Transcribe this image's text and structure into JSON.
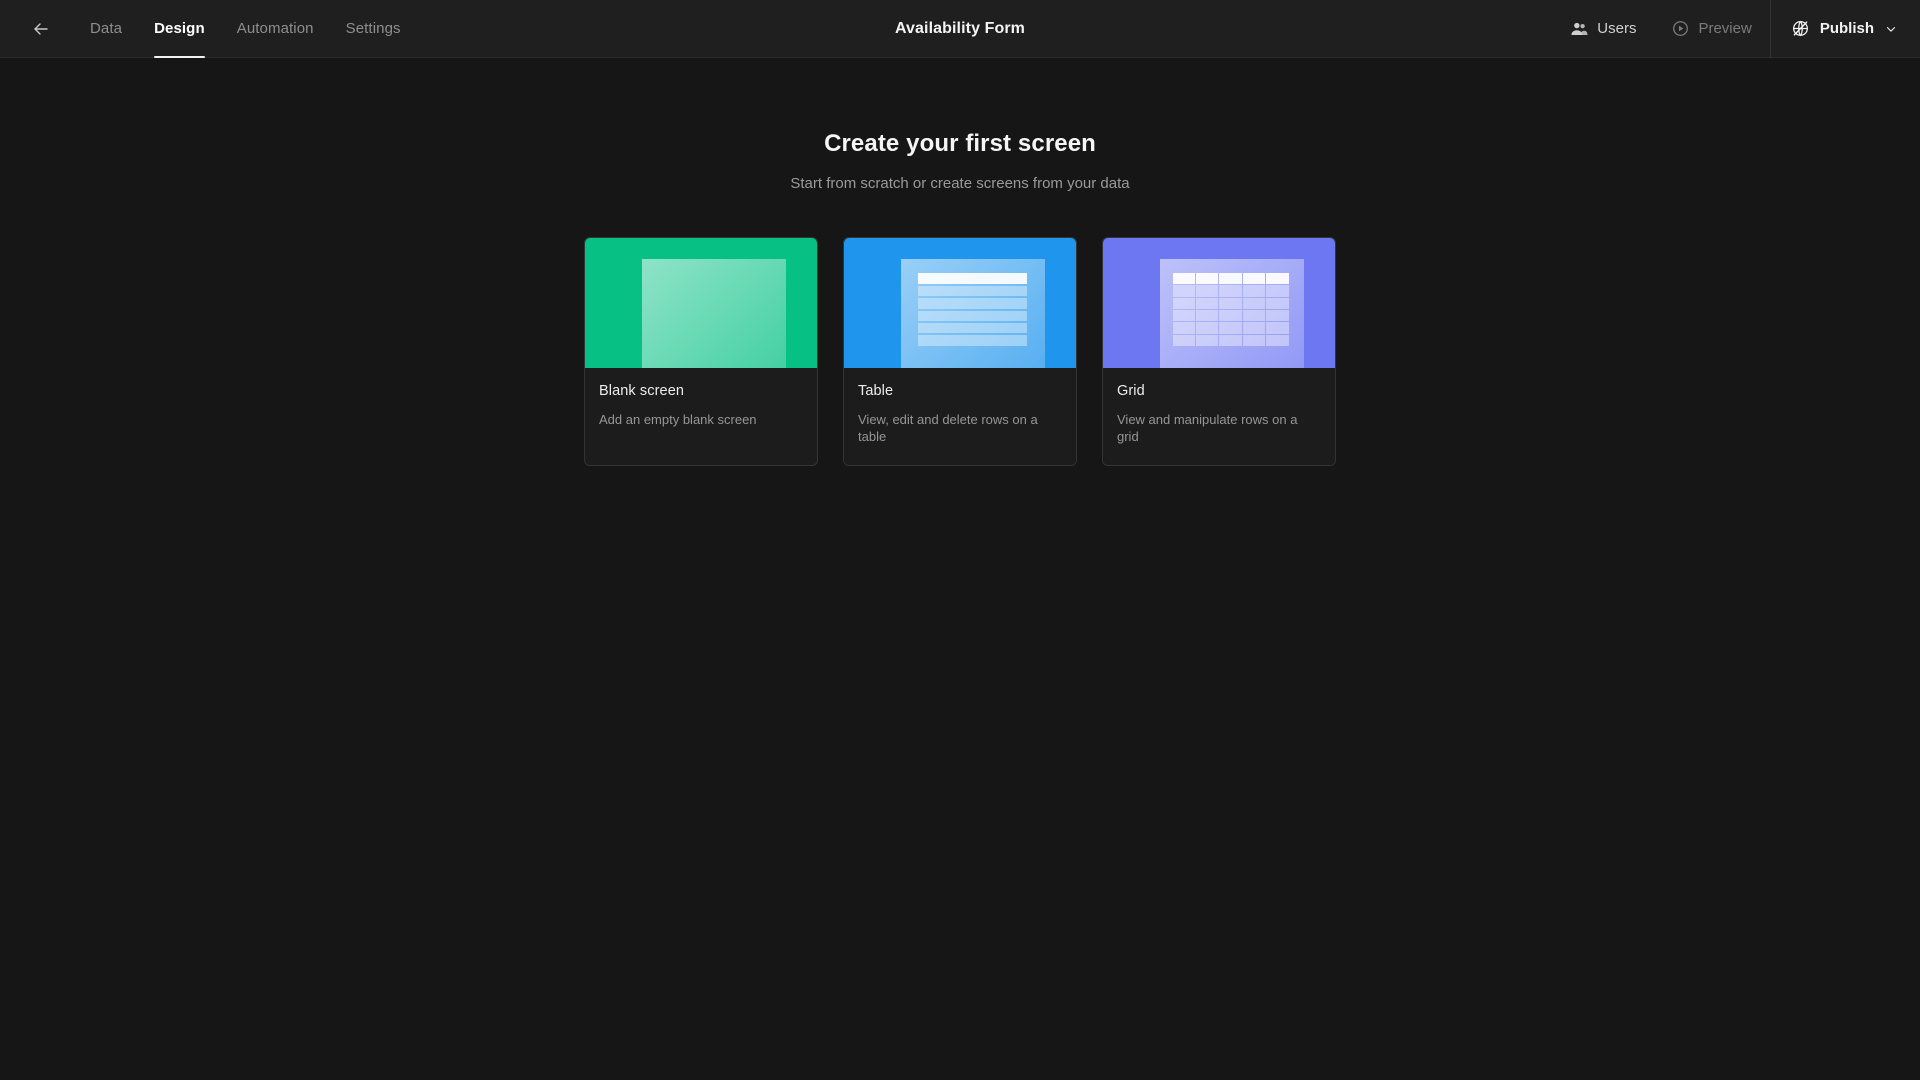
{
  "header": {
    "back_icon": "arrow-left-icon",
    "title": "Availability Form",
    "tabs": [
      {
        "label": "Data",
        "active": false
      },
      {
        "label": "Design",
        "active": true
      },
      {
        "label": "Automation",
        "active": false
      },
      {
        "label": "Settings",
        "active": false
      }
    ],
    "users_label": "Users",
    "users_icon": "users-icon",
    "preview_label": "Preview",
    "preview_icon": "play-circle-icon",
    "publish_label": "Publish",
    "publish_icon": "globe-slash-icon",
    "publish_chevron_icon": "chevron-down-icon"
  },
  "main": {
    "heading": "Create your first screen",
    "subheading": "Start from scratch or create screens from your data",
    "cards": [
      {
        "title": "Blank screen",
        "description": "Add an empty blank screen",
        "color": "#06c183",
        "thumb": "blank-screen-thumbnail"
      },
      {
        "title": "Table",
        "description": "View, edit and delete rows on a table",
        "color": "#1f95ed",
        "thumb": "table-thumbnail"
      },
      {
        "title": "Grid",
        "description": "View and manipulate rows on a grid",
        "color": "#6d77f2",
        "thumb": "grid-thumbnail"
      }
    ]
  },
  "colors": {
    "background": "#161616",
    "topbar": "#1f1f1f",
    "card_background": "#1c1c1c",
    "card_border": "#343434",
    "accent_active": "#ffffff"
  }
}
